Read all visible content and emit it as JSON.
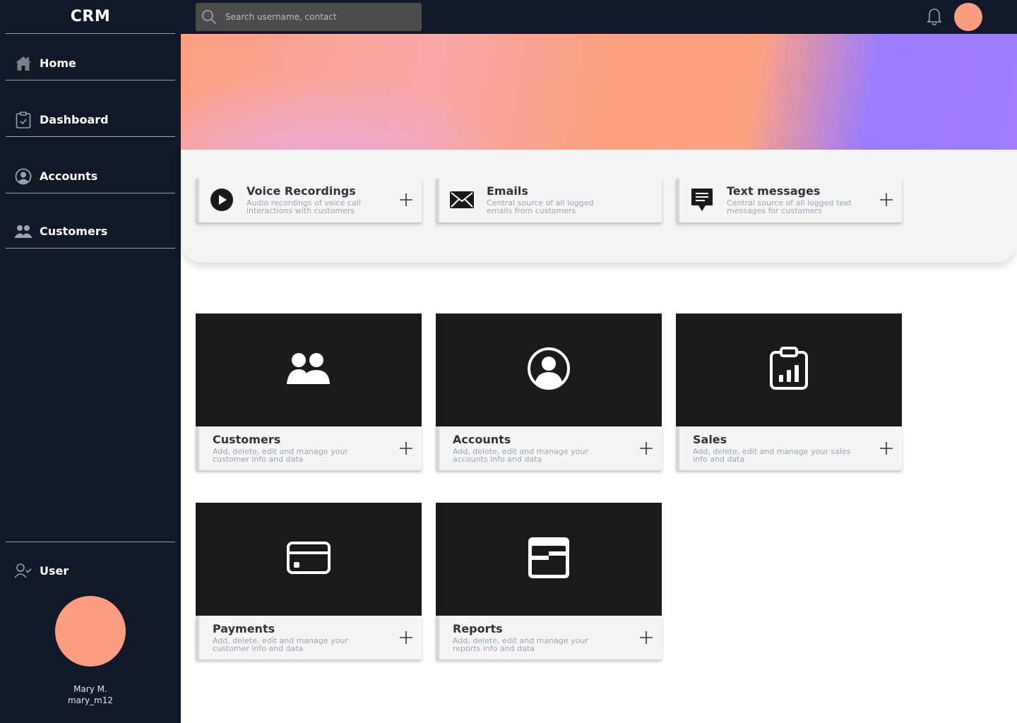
{
  "app": {
    "brand": "CRM"
  },
  "sidebar": {
    "items": [
      {
        "label": "Home",
        "icon": "home-icon"
      },
      {
        "label": "Dashboard",
        "icon": "clipboard-check-icon"
      },
      {
        "label": "Accounts",
        "icon": "user-circle-icon"
      },
      {
        "label": "Customers",
        "icon": "users-icon"
      }
    ],
    "user": {
      "label": "User",
      "icon": "user-check-icon",
      "name": "Mary M.",
      "handle": "mary_m12",
      "avatar_color": "#fd9e82"
    }
  },
  "topbar": {
    "search_placeholder": "Search username, contact",
    "search_icon": "search-icon",
    "bell_icon": "bell-icon",
    "avatar_color": "#fd9e82"
  },
  "quick_cards": [
    {
      "title": "Voice Recordings",
      "subtitle": "Audio recordings of voice call interactions with customers",
      "icon": "play-circle-icon"
    },
    {
      "title": "Emails",
      "subtitle": "Central source of all logged emails from customers",
      "icon": "envelope-icon"
    },
    {
      "title": "Text messages",
      "subtitle": "Central source of all logged text messages for customers",
      "icon": "message-icon"
    }
  ],
  "tiles": [
    {
      "title": "Customers",
      "subtitle": "Add, delete, edit and manage your customer info and data",
      "icon": "users-icon"
    },
    {
      "title": "Accounts",
      "subtitle": "Add, delete, edit and manage your accounts info and data",
      "icon": "user-circle-icon"
    },
    {
      "title": "Sales",
      "subtitle": "Add, delete, edit and manage your sales info and data",
      "icon": "clipboard-chart-icon"
    },
    {
      "title": "Payments",
      "subtitle": "Add, delete, edit and manage your customer info and data",
      "icon": "credit-card-icon"
    },
    {
      "title": "Reports",
      "subtitle": "Add, delete, edit and manage your reports info and data",
      "icon": "report-icon"
    }
  ],
  "colors": {
    "sidebar_bg": "#111827",
    "tile_bg": "#1a1a1a",
    "accent": "#fd9e82"
  }
}
